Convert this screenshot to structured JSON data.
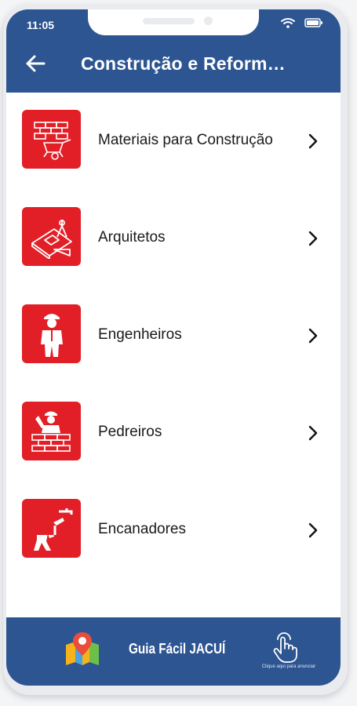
{
  "status_bar": {
    "time": "11:05"
  },
  "header": {
    "title": "Construção e Reform…"
  },
  "categories": [
    {
      "label": "Materiais para Construção",
      "icon": "construction-materials-icon"
    },
    {
      "label": "Arquitetos",
      "icon": "architect-blueprint-icon"
    },
    {
      "label": "Engenheiros",
      "icon": "engineer-icon"
    },
    {
      "label": "Pedreiros",
      "icon": "bricklayer-icon"
    },
    {
      "label": "Encanadores",
      "icon": "plumber-icon"
    }
  ],
  "bottom_bar": {
    "brand": "Guia Fácil JACUÍ",
    "touch_caption": "Clique aqui para anunciar"
  },
  "colors": {
    "primary_blue": "#2d5592",
    "icon_red": "#e21f26",
    "background": "#ffffff"
  }
}
